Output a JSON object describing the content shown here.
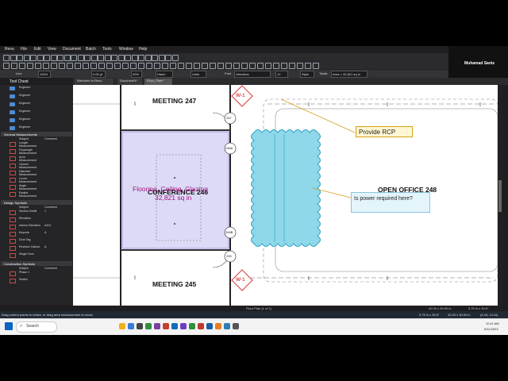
{
  "menu": [
    "Revu",
    "File",
    "Edit",
    "View",
    "Document",
    "Batch",
    "Tools",
    "Window",
    "Help"
  ],
  "user": {
    "name": "Muhamad Sanis"
  },
  "props_bar": {
    "line_label": "Line",
    "opacity": "100%",
    "line_width": "0.00 pt",
    "opacity2": "20%",
    "hatch": "Hatch",
    "units": "Units",
    "font_label": "Font",
    "font_value": "Helvetica",
    "font_size": "12",
    "style_label": "Style",
    "totals_label": "Totals",
    "totals_value": "Area = 32,821 sq in"
  },
  "panel": {
    "title": "Tool Chest",
    "engineer_items": [
      "Engineer",
      "Engineer",
      "Engineer",
      "Engineer",
      "Engineer",
      "Engineer"
    ],
    "sections": [
      {
        "title": "General Measurements",
        "col1": "Subject",
        "col2": "Comment",
        "items": [
          "Length\nMeasurement",
          "Polylength\nMeasurement",
          "Area\nMeasurement",
          "Volume\nMeasurement",
          "Diameter\nMeasurement",
          "Count\nMeasurement",
          "Angle\nMeasurement",
          "Radius\nMeasurement"
        ]
      },
      {
        "title": "Design Symbols",
        "col1": "Subject",
        "col2": "Comment",
        "items": [
          "Section Detail",
          "Elevation",
          "Interior Elevation",
          "Keynote",
          "Door Tag",
          "Revision Callout",
          "Single Door"
        ],
        "comments": [
          "1",
          "",
          "A101",
          "A",
          "",
          "A",
          ""
        ]
      },
      {
        "title": "Construction Symbols",
        "col1": "Subject",
        "col2": "Comment",
        "items": [
          "Phase 1",
          "Switch"
        ]
      }
    ]
  },
  "tabs": [
    "Welcome to Revu",
    "Document1*",
    "Floor_Plan*"
  ],
  "drawing": {
    "room_top": "MEETING  247",
    "room_bottom": "MEETING  245",
    "room_conf": "CONFERENCE  246",
    "room_open": "OPEN OFFICE  248",
    "area_label": "Flooring, Ceiling, Glazing",
    "area_value": "32,821 sq in",
    "tag1": "W-1",
    "tag2": "W-1",
    "door_tags": [
      "247",
      "246A",
      "246B",
      "245"
    ],
    "callout1": "Provide RCP",
    "callout2": "Is power required here?"
  },
  "status": {
    "page": "Floor Plan (1 of 1)",
    "dims": "42.00 x 30.00 in",
    "coords": "3.75 in x 30.6\""
  },
  "message": {
    "text": "Drag control points to resize, or drag area measurement to move.",
    "dims": "3.75 in x 30.6\"",
    "size": "42.00 x 30.00 in",
    "coords": "(4.44, 14.11)"
  },
  "taskbar": {
    "search": "Search",
    "time": "10:11 AM",
    "date": "6/11/2023"
  },
  "colors": {
    "accent": "#d94f4f",
    "area_fill": "#d6d4f5",
    "cloud": "#3bb7d6",
    "callout": "#fff7d1"
  }
}
